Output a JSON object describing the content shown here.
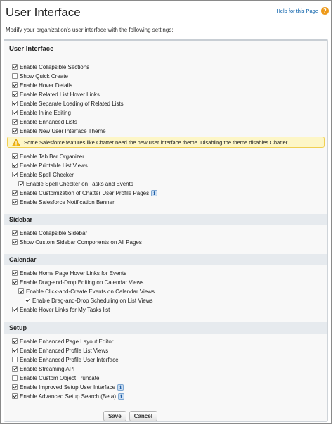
{
  "header": {
    "title": "User Interface",
    "help_link": "Help for this Page",
    "help_icon": "?",
    "subtitle": "Modify your organization's user interface with the following settings:"
  },
  "sections": {
    "ui": {
      "title": "User Interface",
      "items": [
        {
          "label": "Enable Collapsible Sections",
          "checked": true
        },
        {
          "label": "Show Quick Create",
          "checked": false
        },
        {
          "label": "Enable Hover Details",
          "checked": true
        },
        {
          "label": "Enable Related List Hover Links",
          "checked": true
        },
        {
          "label": "Enable Separate Loading of Related Lists",
          "checked": true
        },
        {
          "label": "Enable Inline Editing",
          "checked": true
        },
        {
          "label": "Enable Enhanced Lists",
          "checked": true
        },
        {
          "label": "Enable New User Interface Theme",
          "checked": true
        },
        {
          "label": "Enable Tab Bar Organizer",
          "checked": true
        },
        {
          "label": "Enable Printable List Views",
          "checked": true
        },
        {
          "label": "Enable Spell Checker",
          "checked": true
        },
        {
          "label": "Enable Spell Checker on Tasks and Events",
          "checked": true
        },
        {
          "label": "Enable Customization of Chatter User Profile Pages",
          "checked": true,
          "info": true
        },
        {
          "label": "Enable Salesforce Notification Banner",
          "checked": true
        }
      ],
      "warning": "Some Salesforce features like Chatter need the new user interface theme. Disabling the theme disables Chatter."
    },
    "sidebar": {
      "title": "Sidebar",
      "items": [
        {
          "label": "Enable Collapsible Sidebar",
          "checked": true
        },
        {
          "label": "Show Custom Sidebar Components on All Pages",
          "checked": true
        }
      ]
    },
    "calendar": {
      "title": "Calendar",
      "items": [
        {
          "label": "Enable Home Page Hover Links for Events",
          "checked": true
        },
        {
          "label": "Enable Drag-and-Drop Editing on Calendar Views",
          "checked": true
        },
        {
          "label": "Enable Click-and-Create Events on Calendar Views",
          "checked": true
        },
        {
          "label": "Enable Drag-and-Drop Scheduling on List Views",
          "checked": true
        },
        {
          "label": "Enable Hover Links for My Tasks list",
          "checked": true
        }
      ]
    },
    "setup": {
      "title": "Setup",
      "items": [
        {
          "label": "Enable Enhanced Page Layout Editor",
          "checked": true
        },
        {
          "label": "Enable Enhanced Profile List Views",
          "checked": true
        },
        {
          "label": "Enable Enhanced Profile User Interface",
          "checked": false
        },
        {
          "label": "Enable Streaming API",
          "checked": true
        },
        {
          "label": "Enable Custom Object Truncate",
          "checked": false
        },
        {
          "label": "Enable Improved Setup User Interface",
          "checked": true,
          "info": true
        },
        {
          "label": "Enable Advanced Setup Search (Beta)",
          "checked": true,
          "info": true
        }
      ]
    }
  },
  "info_icon_glyph": "i",
  "buttons": {
    "save": "Save",
    "cancel": "Cancel"
  },
  "colors": {
    "link": "#015ba7",
    "warning_bg": "#fdf6c7",
    "warning_border": "#f0cf52",
    "section_bg": "#e6eaee"
  }
}
